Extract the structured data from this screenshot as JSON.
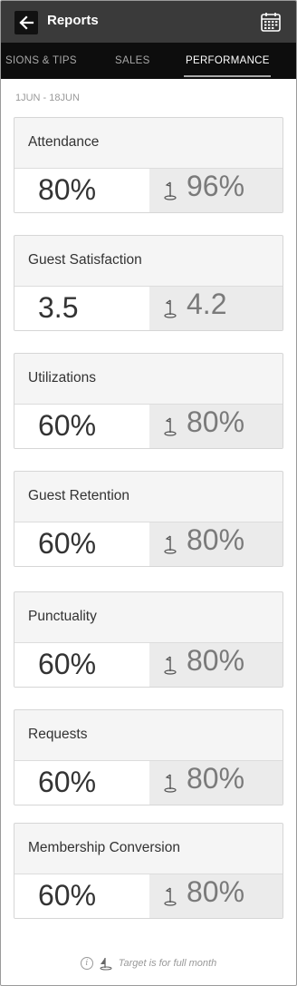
{
  "header": {
    "title": "Reports",
    "back_icon": "arrow-left-icon",
    "calendar_icon": "calendar-icon"
  },
  "tabs": [
    {
      "label": "SIONS & TIPS",
      "active": false
    },
    {
      "label": "SALES",
      "active": false
    },
    {
      "label": "PERFORMANCE",
      "active": true
    }
  ],
  "date_range": "1JUN - 18JUN",
  "metrics": [
    {
      "title": "Attendance",
      "actual": "80%",
      "target": "96%"
    },
    {
      "title": "Guest Satisfaction",
      "actual": "3.5",
      "target": "4.2"
    },
    {
      "title": "Utilizations",
      "actual": "60%",
      "target": "80%"
    },
    {
      "title": "Guest Retention",
      "actual": "60%",
      "target": "80%"
    },
    {
      "title": "Punctuality",
      "actual": "60%",
      "target": "80%"
    },
    {
      "title": "Requests",
      "actual": "60%",
      "target": "80%"
    },
    {
      "title": "Membership Conversion",
      "actual": "60%",
      "target": "80%"
    }
  ],
  "footer": {
    "info_icon": "info-icon",
    "flag_icon": "golf-flag-icon",
    "note": "Target is for full month"
  },
  "colors": {
    "header_bg": "#3a3a3a",
    "tabs_bg": "#0d0d0d",
    "card_bg": "#f5f5f5",
    "target_bg": "#ebebeb"
  }
}
